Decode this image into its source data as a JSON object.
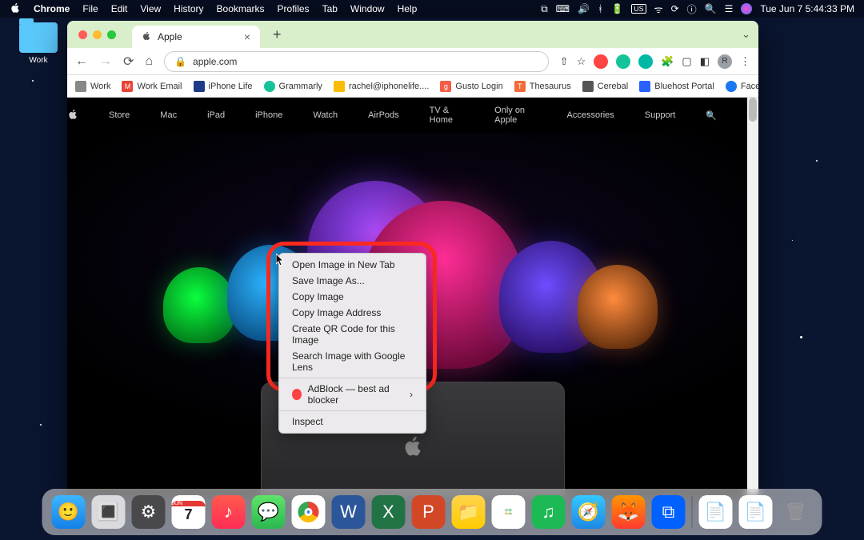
{
  "menubar": {
    "app": "Chrome",
    "items": [
      "File",
      "Edit",
      "View",
      "History",
      "Bookmarks",
      "Profiles",
      "Tab",
      "Window",
      "Help"
    ],
    "datetime": "Tue Jun 7  5:44:33 PM"
  },
  "desktop": {
    "folder_label": "Work"
  },
  "browser": {
    "tab_title": "Apple",
    "url": "apple.com",
    "bookmarks": [
      {
        "label": "Work",
        "color": "#888"
      },
      {
        "label": "Work Email",
        "color": "#ea4335"
      },
      {
        "label": "iPhone Life",
        "color": "#1e3a8a"
      },
      {
        "label": "Grammarly",
        "color": "#15c39a"
      },
      {
        "label": "rachel@iphonelife....",
        "color": "#fbbc04"
      },
      {
        "label": "Gusto Login",
        "color": "#f45d48"
      },
      {
        "label": "Thesaurus",
        "color": "#f26b3a"
      },
      {
        "label": "Cerebal",
        "color": "#555"
      },
      {
        "label": "Bluehost Portal",
        "color": "#2962ff"
      },
      {
        "label": "Facebook",
        "color": "#1877f2"
      }
    ]
  },
  "apple_nav": [
    "Store",
    "Mac",
    "iPad",
    "iPhone",
    "Watch",
    "AirPods",
    "TV & Home",
    "Only on Apple",
    "Accessories",
    "Support"
  ],
  "context_menu": {
    "items1": [
      "Open Image in New Tab",
      "Save Image As...",
      "Copy Image",
      "Copy Image Address",
      "Create QR Code for this Image",
      "Search Image with Google Lens"
    ],
    "adblock": "AdBlock — best ad blocker",
    "inspect": "Inspect"
  },
  "dock_apps": [
    {
      "name": "finder",
      "bg": "linear-gradient(#3fb6ff,#1281e8)"
    },
    {
      "name": "launchpad",
      "bg": "#d9d9de"
    },
    {
      "name": "settings",
      "bg": "#49494c"
    },
    {
      "name": "calendar",
      "bg": "#fff"
    },
    {
      "name": "music",
      "bg": "linear-gradient(#ff5a4e,#ff2d55)"
    },
    {
      "name": "messages",
      "bg": "linear-gradient(#5fe36a,#2bb84f)"
    },
    {
      "name": "chrome",
      "bg": "#fff"
    },
    {
      "name": "word",
      "bg": "#2b579a"
    },
    {
      "name": "excel",
      "bg": "#217346"
    },
    {
      "name": "powerpoint",
      "bg": "#d24726"
    },
    {
      "name": "notes",
      "bg": "linear-gradient(#ffd34e,#ffcc00)"
    },
    {
      "name": "slack",
      "bg": "#fff"
    },
    {
      "name": "spotify",
      "bg": "#1db954"
    },
    {
      "name": "safari",
      "bg": "linear-gradient(#34c7ff,#1e88e5)"
    },
    {
      "name": "firefox",
      "bg": "linear-gradient(#ff9500,#ff3b30)"
    },
    {
      "name": "dropbox",
      "bg": "#0061ff"
    }
  ]
}
